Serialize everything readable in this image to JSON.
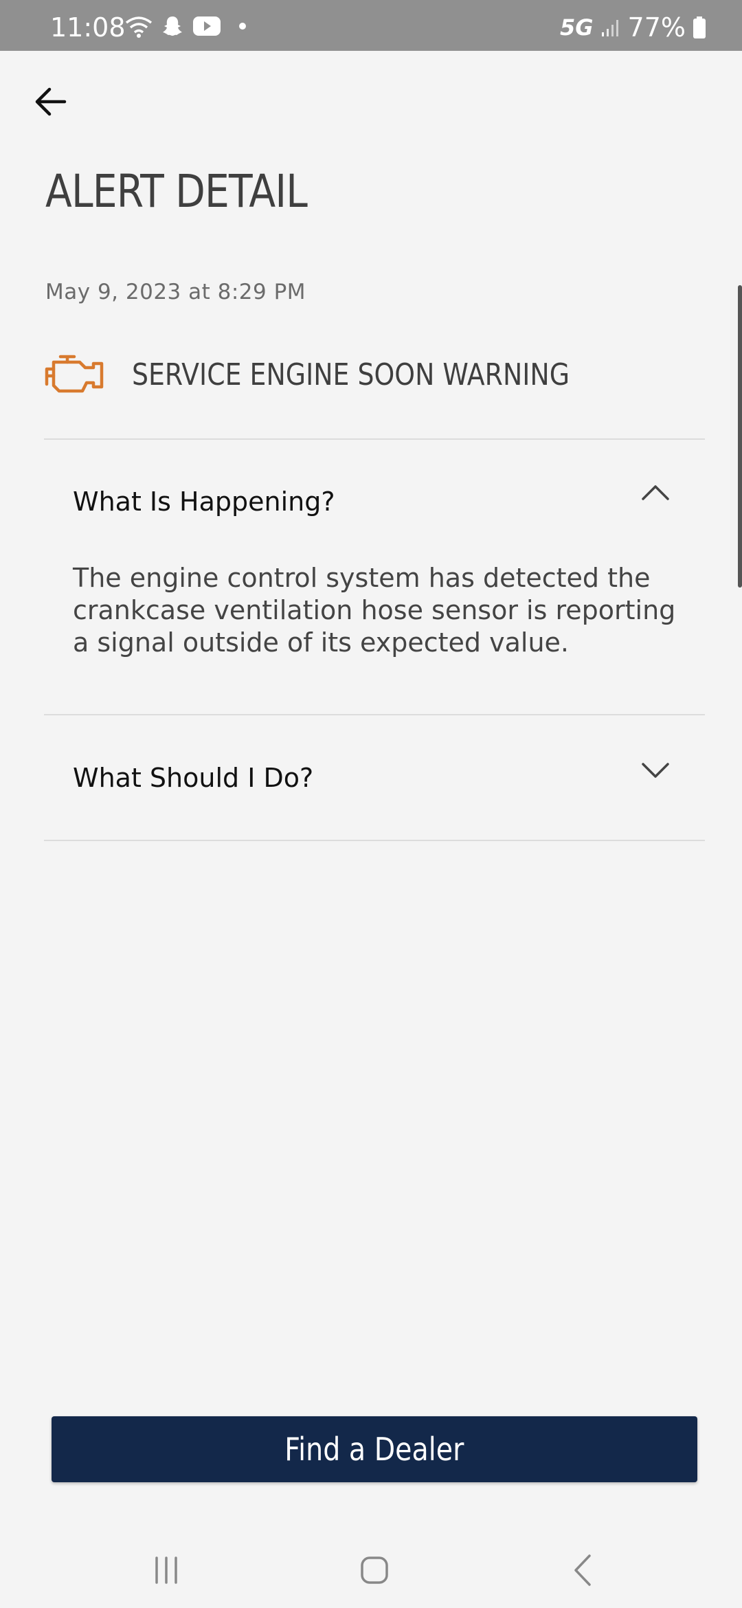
{
  "status_bar": {
    "time": "11:08",
    "network": "5G",
    "battery": "77%",
    "icons": [
      "wifi-icon",
      "snapchat-icon",
      "youtube-icon",
      "dot-icon",
      "signal-icon",
      "battery-icon"
    ]
  },
  "header": {
    "back_icon": "arrow-left-icon",
    "title": "ALERT DETAIL"
  },
  "alert": {
    "timestamp": "May 9, 2023 at 8:29 PM",
    "icon": "engine-icon",
    "icon_color": "#d87a2e",
    "title": "SERVICE ENGINE SOON WARNING"
  },
  "accordion": [
    {
      "label": "What Is Happening?",
      "expanded": true,
      "body": "The engine control system has detected the crankcase ventilation hose sensor is reporting a signal outside of its expected value."
    },
    {
      "label": "What Should I Do?",
      "expanded": false
    }
  ],
  "footer": {
    "button_label": "Find a Dealer",
    "button_color": "#13284a"
  },
  "nav_bar": {
    "icons": [
      "recent-apps-icon",
      "home-icon",
      "back-icon"
    ]
  }
}
